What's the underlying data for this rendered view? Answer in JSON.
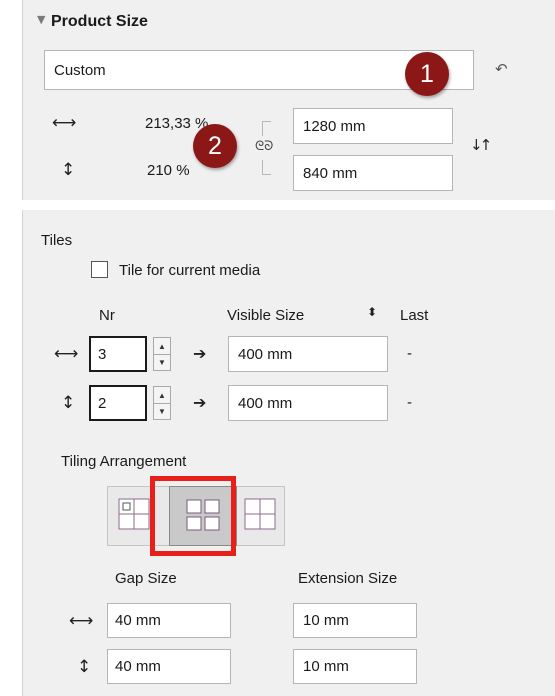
{
  "product_size": {
    "title": "Product Size",
    "preset_value": "Custom",
    "width_percent": "213,33 %",
    "height_percent": "210 %",
    "width_value": "1280 mm",
    "height_value": "840 mm",
    "markers": [
      "1",
      "2"
    ]
  },
  "tiles": {
    "title": "Tiles",
    "tile_for_current_media_label": "Tile for current media",
    "tile_for_current_media_checked": false,
    "col_nr": "Nr",
    "col_visible_size": "Visible Size",
    "col_last": "Last",
    "rows": [
      {
        "nr": "3",
        "visible_size": "400 mm",
        "last": "-"
      },
      {
        "nr": "2",
        "visible_size": "400 mm",
        "last": "-"
      }
    ],
    "tiling_arrangement_label": "Tiling Arrangement",
    "tiling_options": [
      "aligned-corner",
      "grid",
      "offset"
    ],
    "tiling_selected": "grid",
    "gap_size_label": "Gap Size",
    "extension_size_label": "Extension Size",
    "gap_horizontal": "40 mm",
    "gap_vertical": "40 mm",
    "extension_horizontal": "10 mm",
    "extension_vertical": "10 mm"
  },
  "colors": {
    "panel_bg": "#f0f0f0",
    "badge": "#8b1717",
    "highlight_box": "#e8201a"
  }
}
